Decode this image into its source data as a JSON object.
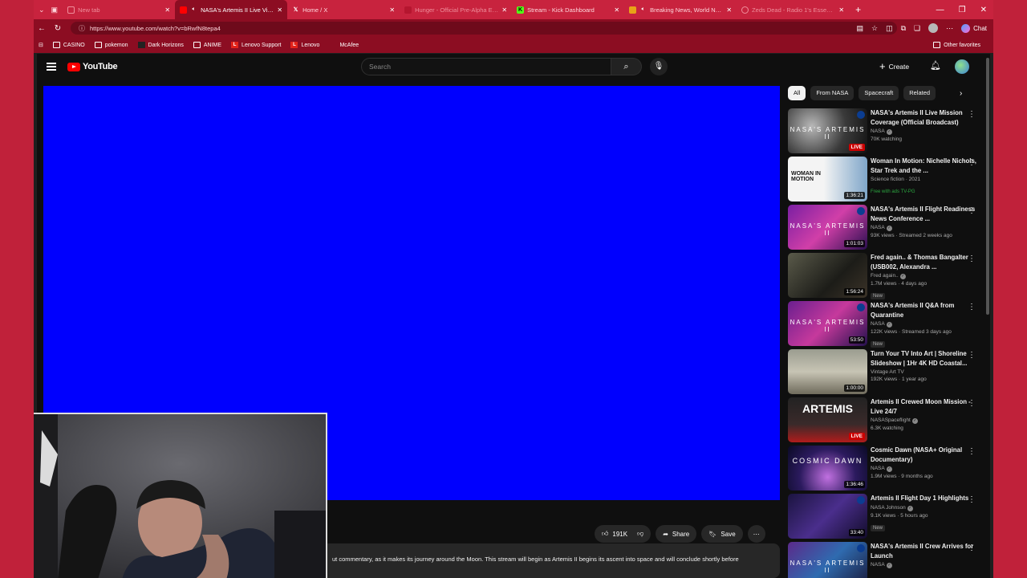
{
  "browser": {
    "tabs": [
      {
        "title": "New tab",
        "favicon": "edge-icon",
        "active": false
      },
      {
        "title": "NASA's Artemis II Live Views",
        "favicon": "speaker-icon",
        "active": true
      },
      {
        "title": "Home / X",
        "favicon": "x-icon",
        "active": false
      },
      {
        "title": "Hunger - Official Pre-Alpha Exten…",
        "favicon": "youtube-icon",
        "active": false
      },
      {
        "title": "Stream - Kick Dashboard",
        "favicon": "kick-icon",
        "active": false
      },
      {
        "title": "Breaking News, World News a…",
        "favicon": "news-icon",
        "active": false
      },
      {
        "title": "Zeds Dead - Radio 1's Essential M…",
        "favicon": "radio-icon",
        "active": false
      }
    ],
    "url": "https://www.youtube.com/watch?v=bRwfN8tepa4",
    "bookmarks": [
      {
        "label": "CASINO",
        "icon": "folder-icon"
      },
      {
        "label": "pokemon",
        "icon": "folder-icon"
      },
      {
        "label": "Dark Horizons",
        "icon": "dark-horizons-icon"
      },
      {
        "label": "ANIME",
        "icon": "folder-icon"
      },
      {
        "label": "Lenovo Support",
        "icon": "lenovo-icon"
      },
      {
        "label": "Lenovo",
        "icon": "lenovo-icon"
      },
      {
        "label": "McAfee",
        "icon": "mcafee-icon"
      }
    ],
    "other_favorites": "Other favorites",
    "chat_label": "Chat"
  },
  "youtube": {
    "logo_text": "YouTube",
    "search_placeholder": "Search",
    "create_label": "Create",
    "player_color": "#0000fe",
    "actions": {
      "likes": "191K",
      "share": "Share",
      "save": "Save"
    },
    "description_snippet": "ut commentary, as it makes its journey around the Moon. This stream will begin as Artemis II begins its ascent into space and will conclude shortly before",
    "chips": [
      "All",
      "From NASA",
      "Spacecraft",
      "Related"
    ],
    "recommendations": [
      {
        "title": "NASA's Artemis II Live Mission Coverage (Official Broadcast)",
        "channel": "NASA",
        "verified": true,
        "stats": "70K watching",
        "badge": "",
        "overlay": "LIVE",
        "thumb_text": "NASA'S ARTEMIS II"
      },
      {
        "title": "Woman In Motion: Nichelle Nichols, Star Trek and the ...",
        "channel": "Science fiction · 2021",
        "verified": false,
        "stats": "",
        "badge": "Free with ads  TV-PG",
        "overlay": "1:36:21",
        "thumb_text": "WOMAN IN MOTION"
      },
      {
        "title": "NASA's Artemis II Flight Readiness News Conference ...",
        "channel": "NASA",
        "verified": true,
        "stats": "93K views · Streamed 2 weeks ago",
        "badge": "",
        "overlay": "1:01:03",
        "thumb_text": "NASA'S ARTEMIS II"
      },
      {
        "title": "Fred again.. & Thomas Bangalter (USB002, Alexandra ...",
        "channel": "Fred again..",
        "verified": true,
        "stats": "1.7M views · 4 days ago",
        "badge": "New",
        "overlay": "1:56:24",
        "thumb_text": ""
      },
      {
        "title": "NASA's Artemis II Q&A from Quarantine",
        "channel": "NASA",
        "verified": true,
        "stats": "122K views · Streamed 3 days ago",
        "badge": "New",
        "overlay": "53:50",
        "thumb_text": "NASA'S ARTEMIS II"
      },
      {
        "title": "Turn Your TV Into Art | Shoreline Slideshow | 1Hr 4K HD Coastal...",
        "channel": "Vintage Art TV",
        "verified": false,
        "stats": "192K views · 1 year ago",
        "badge": "",
        "overlay": "1:00:00",
        "thumb_text": ""
      },
      {
        "title": "Artemis II Crewed Moon Mission - Live 24/7",
        "channel": "NASASpaceflight",
        "verified": true,
        "stats": "6.3K watching",
        "badge": "",
        "overlay": "LIVE",
        "thumb_text": "ARTEMIS"
      },
      {
        "title": "Cosmic Dawn (NASA+ Original Documentary)",
        "channel": "NASA",
        "verified": true,
        "stats": "1.9M views · 9 months ago",
        "badge": "",
        "overlay": "1:36:46",
        "thumb_text": "COSMIC DAWN"
      },
      {
        "title": "Artemis II Flight Day 1 Highlights",
        "channel": "NASA Johnson",
        "verified": true,
        "stats": "9.1K views · 5 hours ago",
        "badge": "New",
        "overlay": "33:40",
        "thumb_text": ""
      },
      {
        "title": "NASA's Artemis II Crew Arrives for Launch",
        "channel": "NASA",
        "verified": true,
        "stats": "",
        "badge": "",
        "overlay": "",
        "thumb_text": "NASA'S ARTEMIS II"
      }
    ]
  }
}
